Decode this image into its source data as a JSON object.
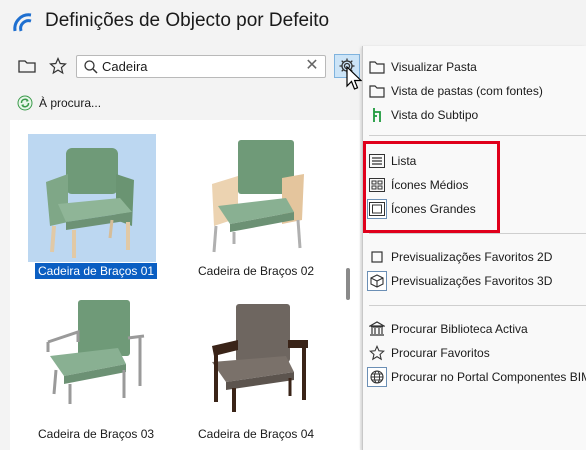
{
  "window": {
    "title": "Definições de Objecto por Defeito"
  },
  "toolbar": {
    "search_value": "Cadeira",
    "clear_symbol": "✕"
  },
  "status": {
    "text": "À procura..."
  },
  "items": [
    {
      "label": "Cadeira de Braços 01",
      "selected": true
    },
    {
      "label": "Cadeira de Braços 02",
      "selected": false
    },
    {
      "label": "Cadeira de Braços 03",
      "selected": false
    },
    {
      "label": "Cadeira de Braços 04",
      "selected": false
    }
  ],
  "menu": {
    "items": [
      {
        "label": "Visualizar Pasta",
        "icon": "folder-icon"
      },
      {
        "label": "Vista de pastas (com fontes)",
        "icon": "folder-icon"
      },
      {
        "label": "Vista do Subtipo",
        "icon": "subtype-icon"
      },
      {
        "label": "Lista",
        "icon": "list-icon"
      },
      {
        "label": "Ícones Médios",
        "icon": "medium-icons-icon"
      },
      {
        "label": "Ícones Grandes",
        "icon": "large-icons-icon"
      },
      {
        "label": "Previsualizações Favoritos 2D",
        "icon": "preview-2d-icon"
      },
      {
        "label": "Previsualizações Favoritos 3D",
        "icon": "preview-3d-icon"
      },
      {
        "label": "Procurar Biblioteca Activa",
        "icon": "library-icon"
      },
      {
        "label": "Procurar Favoritos",
        "icon": "star-icon"
      },
      {
        "label": "Procurar no Portal Componentes BIM",
        "icon": "globe-icon"
      }
    ]
  },
  "colors": {
    "selection": "#0a5ec2",
    "highlight_box": "#e0001b",
    "chair_fabric": "#7fa487"
  }
}
